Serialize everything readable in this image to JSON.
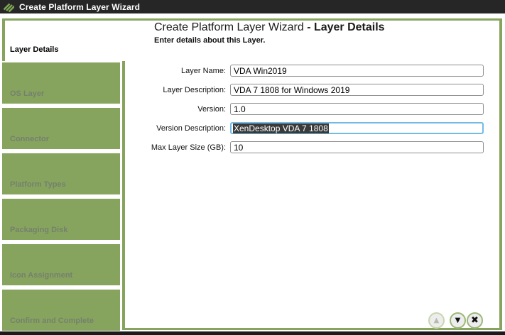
{
  "window": {
    "title": "Create Platform Layer Wizard"
  },
  "colors": {
    "titlebar_bg": "#262626",
    "accent_green": "#87A45E",
    "sidebar_inactive_text": "#75806E",
    "focus_border": "#74BBE4",
    "selection_bg": "#3A3A3A",
    "selection_text": "#FFFFFF",
    "bottom_strip": "#1B1B1B"
  },
  "sidebar": {
    "items": [
      {
        "label": "Layer Details",
        "active": true
      },
      {
        "label": "OS Layer",
        "active": false
      },
      {
        "label": "Connector",
        "active": false
      },
      {
        "label": "Platform Types",
        "active": false
      },
      {
        "label": "Packaging Disk",
        "active": false
      },
      {
        "label": "Icon Assignment",
        "active": false
      },
      {
        "label": "Confirm and Complete",
        "active": false
      }
    ]
  },
  "content": {
    "heading_prefix": "Create Platform Layer Wizard ",
    "heading_emphasis": "- Layer Details",
    "subtitle": "Enter details about this Layer.",
    "fields": [
      {
        "label": "Layer Name:",
        "value": "VDA Win2019",
        "state": "normal"
      },
      {
        "label": "Layer Description:",
        "value": "VDA 7 1808 for Windows 2019",
        "state": "normal"
      },
      {
        "label": "Version:",
        "value": "1.0",
        "state": "normal"
      },
      {
        "label": "Version Description:",
        "value": "XenDesktop VDA 7 1808",
        "state": "focused-text-selected"
      },
      {
        "label": "Max Layer Size (GB):",
        "value": "10",
        "state": "normal"
      }
    ]
  },
  "nav": {
    "up_glyph": "▲",
    "down_glyph": "▼",
    "close_glyph": "✖",
    "up_disabled": true
  }
}
